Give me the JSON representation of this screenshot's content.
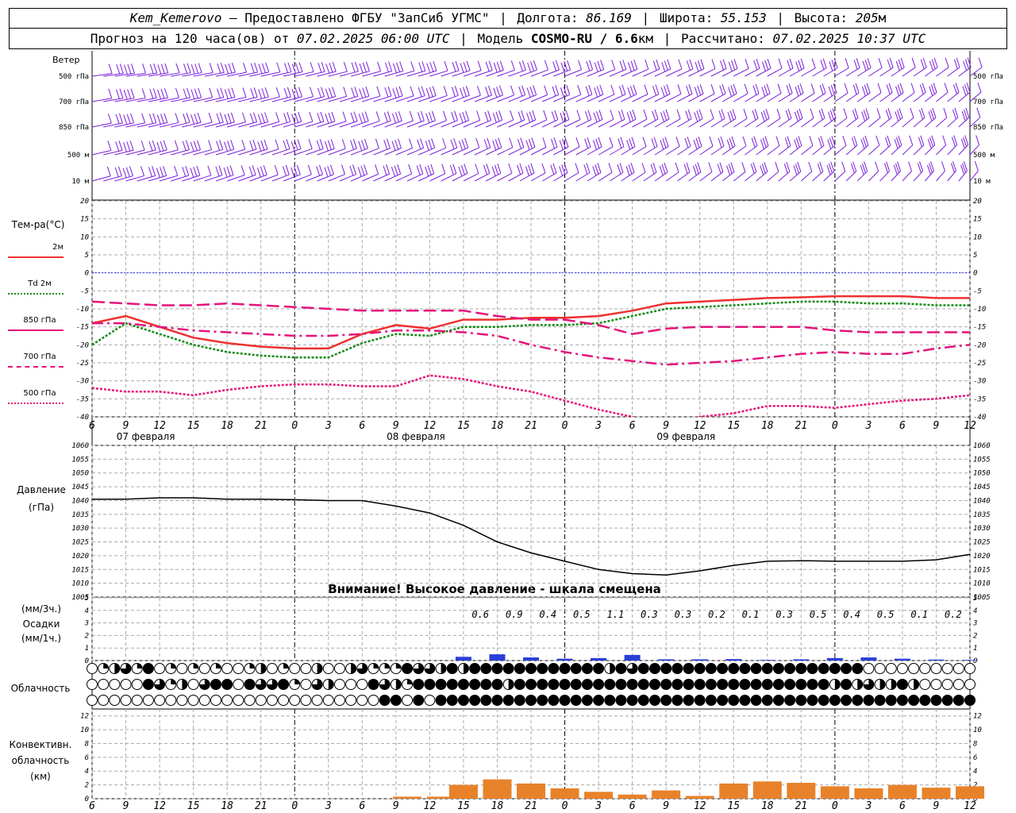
{
  "header": {
    "station": "Kem_Kemerovo",
    "provider": "— Предоставлено ФГБУ \"ЗапСиб УГМС\"",
    "lon_label": "Долгота:",
    "lon": "86.169",
    "lat_label": "Широта:",
    "lat": "55.153",
    "alt_label": "Высота:",
    "alt": "205",
    "alt_unit": "м",
    "forecast_label": "Прогноз на 120 часа(ов) от",
    "forecast_start": "07.02.2025 06:00 UTC",
    "model_label": "Модель",
    "model": "COSMO-RU / 6.6",
    "model_unit": "км",
    "calc_label": "Рассчитано:",
    "calc_time": "07.02.2025 10:37 UTC"
  },
  "labels": {
    "wind": "Ветер",
    "wind_levels": [
      "500 гПа",
      "700 гПа",
      "850 гПа",
      "500 м",
      "10 м"
    ],
    "temp_title": "Тем-ра(°С)",
    "temp_legend": [
      "2м",
      "Td 2м",
      "850 гПа",
      "700 гПа",
      "500 гПа"
    ],
    "pressure_title": "Давление",
    "pressure_unit": "(гПа)",
    "pressure_warning": "Внимание! Высокое давление - шкала смещена",
    "precip_unit_3h": "(мм/3ч.)",
    "precip_title": "Осадки",
    "precip_unit_1h": "(мм/1ч.)",
    "cloud_title": "Облачность",
    "conv_title": "Конвективн. облачность (км)"
  },
  "time_axis": {
    "tick_hours": [
      "6",
      "9",
      "12",
      "15",
      "18",
      "21",
      "0",
      "3",
      "6",
      "9",
      "12",
      "15",
      "18",
      "21",
      "0",
      "3",
      "6",
      "9",
      "12",
      "15",
      "18",
      "21",
      "0",
      "3",
      "6",
      "9",
      "12"
    ],
    "dates": [
      "07 февраля",
      "08 февраля",
      "09 февраля"
    ]
  },
  "colors": {
    "t2m": "#ee3030",
    "td2m": "#138a13",
    "t850": "#e3147a",
    "t700": "#e3147a",
    "t500": "#e3147a",
    "wind": "#7a1fd8",
    "pressure": "#000000",
    "precip": "#2a3fd6",
    "conv": "#e8822a",
    "zero": "#3030ff"
  },
  "chart_data": [
    {
      "type": "line",
      "name": "temperature",
      "ylim": [
        -40,
        20
      ],
      "yticks": [
        20,
        15,
        10,
        5,
        0,
        -5,
        -10,
        -15,
        -20,
        -25,
        -30,
        -35,
        -40
      ],
      "x_hours": [
        0,
        3,
        6,
        9,
        12,
        15,
        18,
        21,
        24,
        27,
        30,
        33,
        36,
        39,
        42,
        45,
        48,
        51,
        54,
        57,
        60,
        63,
        66,
        69,
        72,
        75,
        78
      ],
      "series": [
        {
          "name": "2м",
          "values": [
            -14,
            -12,
            -15,
            -18,
            -19.5,
            -20.5,
            -21,
            -21,
            -17,
            -14.5,
            -15.5,
            -13,
            -13,
            -12.5,
            -12.5,
            -12,
            -10.5,
            -8.5,
            -8,
            -7.5,
            -7,
            -6.8,
            -6.5,
            -6.5,
            -6.5,
            -7,
            -7
          ]
        },
        {
          "name": "Td 2м",
          "values": [
            -20,
            -14,
            -17,
            -20,
            -22,
            -23,
            -23.5,
            -23.5,
            -19.5,
            -17,
            -17.5,
            -15,
            -15,
            -14.5,
            -14.5,
            -14,
            -12,
            -10,
            -9.5,
            -9,
            -8.5,
            -8,
            -8,
            -8.5,
            -8.5,
            -9,
            -9
          ]
        },
        {
          "name": "850 гПа",
          "values": [
            -8,
            -8.5,
            -9,
            -9,
            -8.5,
            -9,
            -9.5,
            -10,
            -10.5,
            -10.5,
            -10.5,
            -10.5,
            -12,
            -13,
            -13,
            -14.5,
            -17,
            -15.5,
            -15,
            -15,
            -15,
            -15,
            -16,
            -16.5,
            -16.5,
            -16.5,
            -16.5
          ]
        },
        {
          "name": "700 гПа",
          "values": [
            -14,
            -14,
            -15,
            -16,
            -16.5,
            -17,
            -17.5,
            -17.5,
            -17,
            -16,
            -16,
            -16.5,
            -17.5,
            -20,
            -22,
            -23.5,
            -24.5,
            -25.5,
            -25,
            -24.5,
            -23.5,
            -22.5,
            -22,
            -22.5,
            -22.5,
            -21,
            -20
          ]
        },
        {
          "name": "500 гПа",
          "values": [
            -32,
            -33,
            -33,
            -34,
            -32.5,
            -31.5,
            -31,
            -31,
            -31.5,
            -31.5,
            -28.5,
            -29.5,
            -31.5,
            -33,
            -35.5,
            -38,
            -40,
            -42,
            -40,
            -39,
            -37,
            -37,
            -37.5,
            -36.5,
            -35.5,
            -35,
            -34
          ]
        }
      ]
    },
    {
      "type": "line",
      "name": "pressure",
      "ylim": [
        1005,
        1060
      ],
      "yticks": [
        1060,
        1055,
        1050,
        1045,
        1040,
        1035,
        1030,
        1025,
        1020,
        1015,
        1010,
        1005
      ],
      "x_hours": [
        0,
        3,
        6,
        9,
        12,
        15,
        18,
        21,
        24,
        27,
        30,
        33,
        36,
        39,
        42,
        45,
        48,
        51,
        54,
        57,
        60,
        63,
        66,
        69,
        72,
        75,
        78
      ],
      "series": [
        {
          "name": "pressure",
          "values": [
            1040.5,
            1040.5,
            1041,
            1041,
            1040.5,
            1040.5,
            1040.3,
            1040,
            1040,
            1038,
            1035.5,
            1031,
            1025,
            1021,
            1018,
            1015,
            1013.5,
            1013,
            1014.5,
            1016.5,
            1018,
            1018.2,
            1018,
            1018,
            1018,
            1018.5,
            1020.5
          ]
        }
      ]
    },
    {
      "type": "bar",
      "name": "precipitation",
      "ylim": [
        0,
        5
      ],
      "yticks": [
        5,
        4,
        3,
        2,
        1,
        0
      ],
      "x_hours": [
        33,
        36,
        39,
        42,
        45,
        48,
        51,
        54,
        57,
        60,
        63,
        66,
        69,
        72,
        75,
        78
      ],
      "totals_3h": [
        "0.6",
        "0.9",
        "0.4",
        "0.5",
        "1.1",
        "0.3",
        "0.3",
        "0.2",
        "0.1",
        "0.3",
        "0.5",
        "0.4",
        "0.5",
        "0.1",
        "0.2"
      ],
      "values_1h": [
        0.3,
        0.5,
        0.25,
        0.15,
        0.2,
        0.45,
        0.1,
        0.1,
        0.12,
        0.05,
        0.1,
        0.2,
        0.25,
        0.15,
        0.08,
        0.05
      ]
    },
    {
      "type": "bar",
      "name": "convective_clouds",
      "ylim": [
        0,
        13
      ],
      "yticks": [
        12,
        10,
        8,
        6,
        4,
        2,
        0
      ],
      "x_hours": [
        28,
        31,
        33,
        36,
        39,
        42,
        45,
        48,
        51,
        54,
        57,
        60,
        63,
        66,
        69,
        72,
        75,
        78
      ],
      "values": [
        0.3,
        0.3,
        2.0,
        2.8,
        2.2,
        1.5,
        1.0,
        0.6,
        1.2,
        0.4,
        2.2,
        2.5,
        2.3,
        1.8,
        1.5,
        2.0,
        1.6,
        1.8
      ]
    }
  ]
}
